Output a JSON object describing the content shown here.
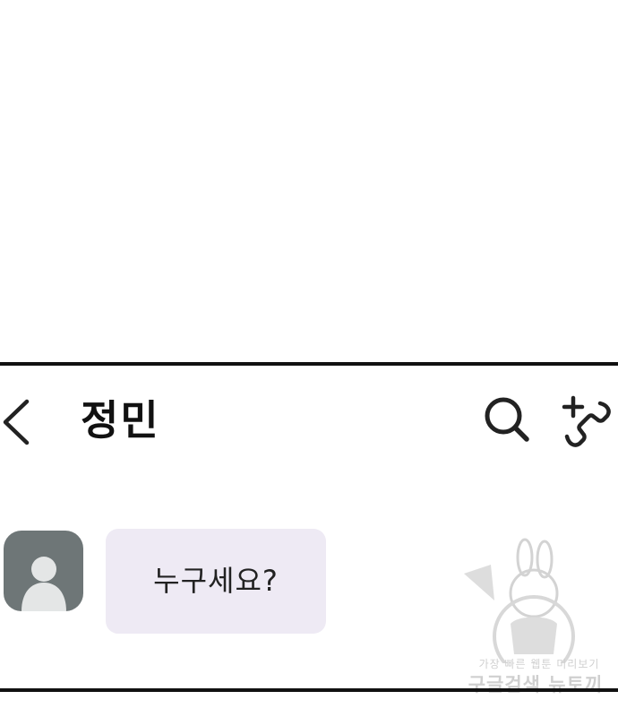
{
  "chat": {
    "title": "정민"
  },
  "icons": {
    "back": "chevron-left-icon",
    "search": "search-icon",
    "call": "add-call-icon",
    "avatar": "person-silhouette-icon"
  },
  "messages": [
    {
      "sender": "contact",
      "text": "누구세요?"
    }
  ],
  "watermark": {
    "line1": "가장 빠른 웹툰 미리보기",
    "line2": "구글검색 뉴토끼"
  },
  "colors": {
    "avatar_bg": "#6e7677",
    "bubble_bg": "#eeeaf4",
    "border": "#111111"
  }
}
